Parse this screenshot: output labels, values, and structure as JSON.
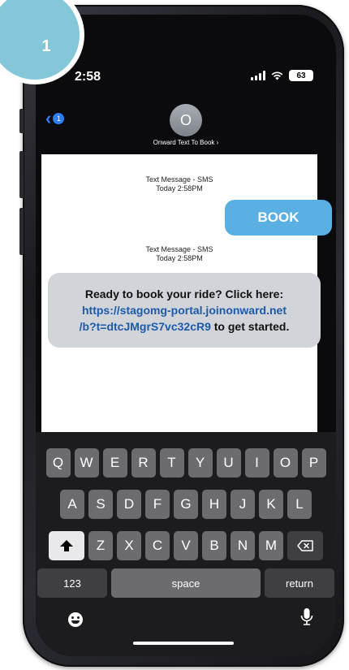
{
  "step": {
    "number": "1"
  },
  "status_bar": {
    "time": "2:58",
    "battery": "63"
  },
  "header": {
    "back_count": "1",
    "avatar_initial": "O",
    "contact_name": "Onward Text To Book"
  },
  "messages": [
    {
      "meta_line1": "Text Message - SMS",
      "meta_line2": "Today 2:58PM",
      "text": "BOOK",
      "direction": "outgoing"
    },
    {
      "meta_line1": "Text Message - SMS",
      "meta_line2": "Today 2:58PM",
      "direction": "incoming",
      "text_before": "Ready to book your ride? Click here:",
      "link_part1": "https://stagomg-portal.joinonward.net",
      "link_part2": "/b?t=dtcJMgrS7vc32cR9",
      "text_after": " to get started."
    }
  ],
  "keyboard": {
    "row1": [
      "Q",
      "W",
      "E",
      "R",
      "T",
      "Y",
      "U",
      "I",
      "O",
      "P"
    ],
    "row2": [
      "A",
      "S",
      "D",
      "F",
      "G",
      "H",
      "J",
      "K",
      "L"
    ],
    "row3": [
      "Z",
      "X",
      "C",
      "V",
      "B",
      "N",
      "M"
    ],
    "numbers_label": "123",
    "space_label": "space",
    "return_label": "return"
  },
  "colors": {
    "outgoing_bubble": "#5ab0e2",
    "incoming_bubble": "#d1d5d9",
    "link": "#1d5aa8",
    "badge": "#83c7d9"
  }
}
